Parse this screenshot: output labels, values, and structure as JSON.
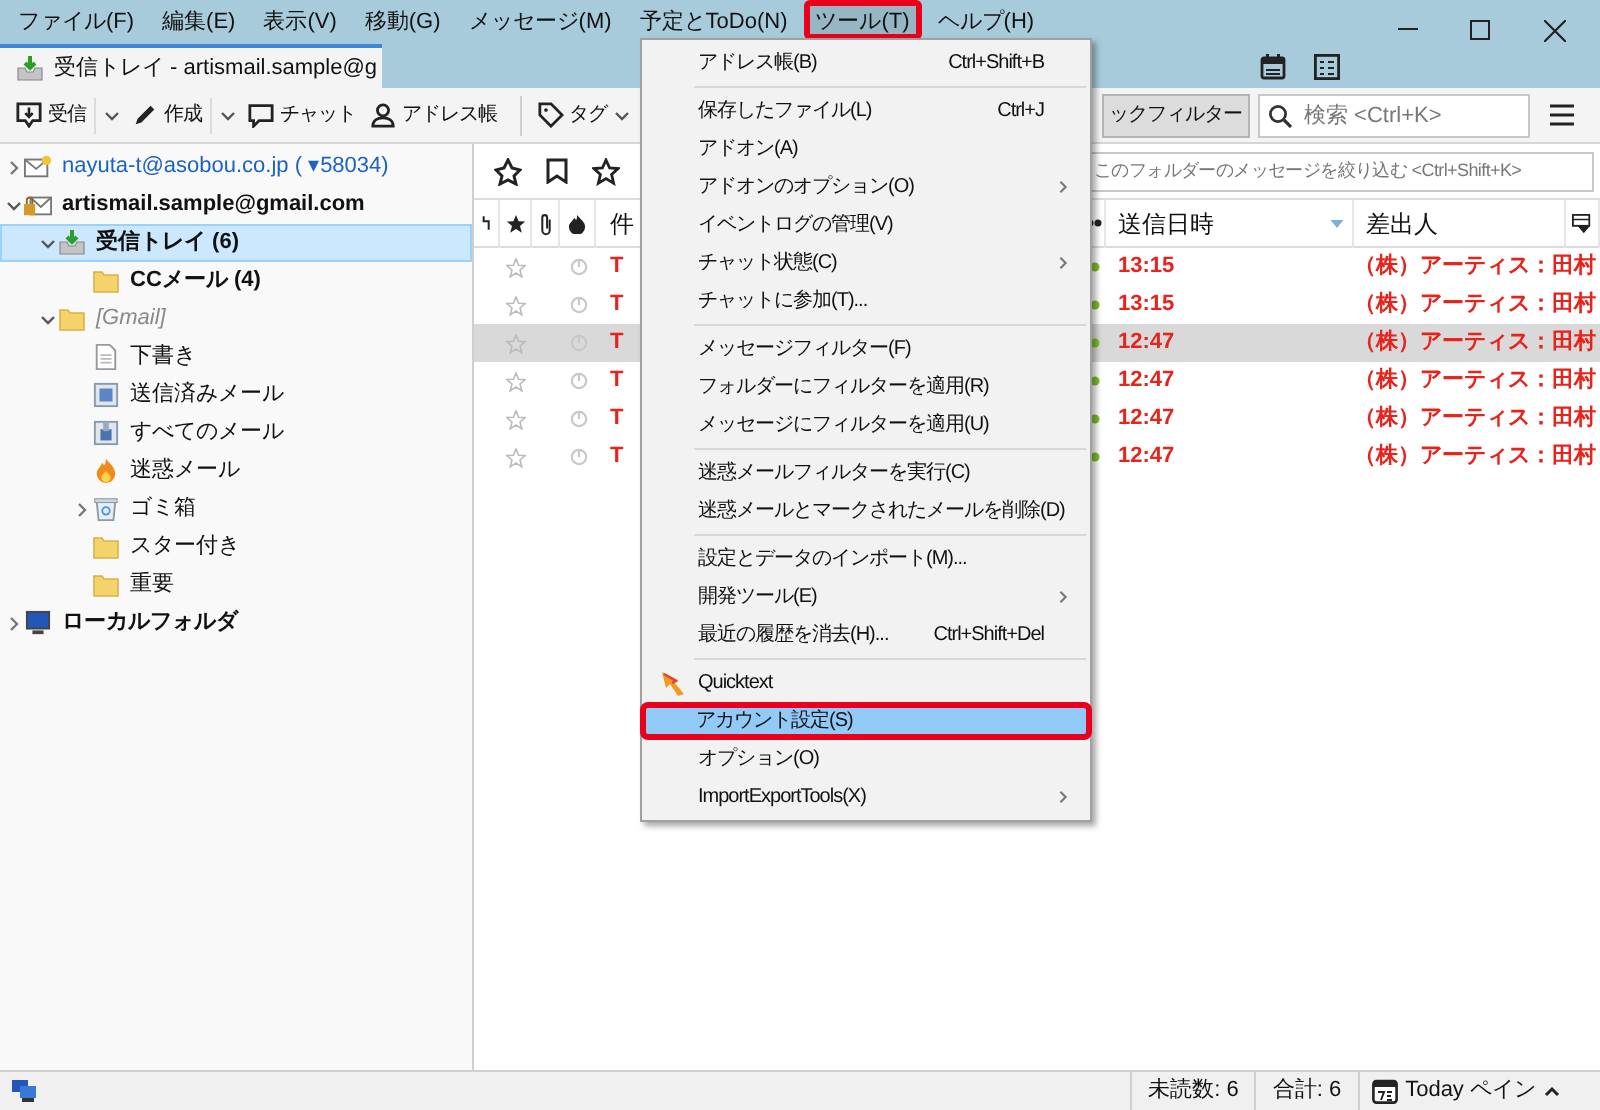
{
  "menu_bar": [
    {
      "label": "ファイル(F)",
      "annotated": false
    },
    {
      "label": "編集(E)",
      "annotated": false
    },
    {
      "label": "表示(V)",
      "annotated": false
    },
    {
      "label": "移動(G)",
      "annotated": false
    },
    {
      "label": "メッセージ(M)",
      "annotated": false
    },
    {
      "label": "予定とToDo(N)",
      "annotated": false
    },
    {
      "label": "ツール(T)",
      "annotated": true
    },
    {
      "label": "ヘルプ(H)",
      "annotated": false
    }
  ],
  "tabs": [
    {
      "label": "受信トレイ - artismail.sample@g",
      "selected": true
    }
  ],
  "toolbar": [
    {
      "kind": "get",
      "label": "受信",
      "dropdown": true
    },
    {
      "kind": "write",
      "label": "作成",
      "dropdown": true
    },
    {
      "kind": "chat",
      "label": "チャット",
      "dropdown": false
    },
    {
      "kind": "contacts",
      "label": "アドレス帳",
      "dropdown": false
    },
    {
      "kind": "tag",
      "label": "タグ",
      "dropdown": true
    }
  ],
  "quick_filter": {
    "button": "ックフィルター",
    "search_placeholder": "検索 <Ctrl+K>",
    "filter_placeholder": "このフォルダーのメッセージを絞り込む <Ctrl+Shift+K>"
  },
  "folders": [
    {
      "kind": "account",
      "label": "nayuta-t@asobou.co.jp ( ▾58034)",
      "new_mail": true,
      "bold": false,
      "selected": false,
      "expanded": false
    },
    {
      "kind": "account-locked",
      "label": "artismail.sample@gmail.com",
      "new_mail": false,
      "bold": true,
      "selected": false,
      "expanded": true,
      "children": [
        {
          "kind": "inbox",
          "label": "受信トレイ (6)",
          "new_mail": false,
          "bold": true,
          "selected": true,
          "expanded": true,
          "children": [
            {
              "kind": "folder",
              "label": "CCメール (4)",
              "new_mail": false,
              "bold": true,
              "selected": false
            }
          ]
        },
        {
          "kind": "virtual",
          "label": "[Gmail]",
          "new_mail": false,
          "bold": false,
          "selected": false,
          "expanded": true,
          "children": [
            {
              "kind": "drafts",
              "label": "下書き",
              "new_mail": false,
              "bold": false,
              "selected": false
            },
            {
              "kind": "sent",
              "label": "送信済みメール",
              "new_mail": false,
              "bold": false,
              "selected": false
            },
            {
              "kind": "archive",
              "label": "すべてのメール",
              "new_mail": false,
              "bold": false,
              "selected": false
            },
            {
              "kind": "junk",
              "label": "迷惑メール",
              "new_mail": false,
              "bold": false,
              "selected": false
            },
            {
              "kind": "trash",
              "label": "ゴミ箱",
              "new_mail": false,
              "bold": false,
              "selected": false,
              "expanded": false
            },
            {
              "kind": "folder",
              "label": "スター付き",
              "new_mail": false,
              "bold": false,
              "selected": false
            },
            {
              "kind": "folder",
              "label": "重要",
              "new_mail": false,
              "bold": false,
              "selected": false
            }
          ]
        }
      ]
    },
    {
      "kind": "local",
      "label": "ローカルフォルダ",
      "new_mail": false,
      "bold": true,
      "selected": false,
      "expanded": false
    }
  ],
  "message_list": {
    "columns": [
      {
        "label": "件"
      },
      {
        "label": "送信日時",
        "sorted": true
      },
      {
        "label": "差出人",
        "sorted": false
      }
    ],
    "rows": [
      {
        "subject": "T",
        "date": "13:15",
        "sender": "（株）アーティス：田村",
        "selected": false
      },
      {
        "subject": "T",
        "date": "13:15",
        "sender": "（株）アーティス：田村",
        "selected": false
      },
      {
        "subject": "T",
        "date": "12:47",
        "sender": "（株）アーティス：田村",
        "selected": true
      },
      {
        "subject": "T",
        "date": "12:47",
        "sender": "（株）アーティス：田村",
        "selected": false
      },
      {
        "subject": "T",
        "date": "12:47",
        "sender": "（株）アーティス：田村",
        "selected": false
      },
      {
        "subject": "T",
        "date": "12:47",
        "sender": "（株）アーティス：田村",
        "selected": false
      }
    ]
  },
  "tools_menu": [
    {
      "kind": "item",
      "label": "アドレス帳(B)",
      "shortcut": "Ctrl+Shift+B",
      "submenu": false,
      "highlighted": false,
      "annotated": false
    },
    {
      "kind": "separator"
    },
    {
      "kind": "item",
      "label": "保存したファイル(L)",
      "shortcut": "Ctrl+J",
      "submenu": false,
      "highlighted": false,
      "annotated": false
    },
    {
      "kind": "item",
      "label": "アドオン(A)",
      "submenu": false,
      "highlighted": false,
      "annotated": false
    },
    {
      "kind": "item",
      "label": "アドオンのオプション(O)",
      "submenu": true,
      "highlighted": false,
      "annotated": false
    },
    {
      "kind": "item",
      "label": "イベントログの管理(V)",
      "submenu": false,
      "highlighted": false,
      "annotated": false
    },
    {
      "kind": "item",
      "label": "チャット状態(C)",
      "submenu": true,
      "highlighted": false,
      "annotated": false
    },
    {
      "kind": "item",
      "label": "チャットに参加(T)...",
      "submenu": false,
      "highlighted": false,
      "annotated": false
    },
    {
      "kind": "separator"
    },
    {
      "kind": "item",
      "label": "メッセージフィルター(F)",
      "submenu": false,
      "highlighted": false,
      "annotated": false
    },
    {
      "kind": "item",
      "label": "フォルダーにフィルターを適用(R)",
      "submenu": false,
      "highlighted": false,
      "annotated": false
    },
    {
      "kind": "item",
      "label": "メッセージにフィルターを適用(U)",
      "submenu": false,
      "highlighted": false,
      "annotated": false
    },
    {
      "kind": "separator"
    },
    {
      "kind": "item",
      "label": "迷惑メールフィルターを実行(C)",
      "submenu": false,
      "highlighted": false,
      "annotated": false
    },
    {
      "kind": "item",
      "label": "迷惑メールとマークされたメールを削除(D)",
      "submenu": false,
      "highlighted": false,
      "annotated": false
    },
    {
      "kind": "separator"
    },
    {
      "kind": "item",
      "label": "設定とデータのインポート(M)...",
      "submenu": false,
      "highlighted": false,
      "annotated": false
    },
    {
      "kind": "item",
      "label": "開発ツール(E)",
      "submenu": true,
      "highlighted": false,
      "annotated": false
    },
    {
      "kind": "item",
      "label": "最近の履歴を消去(H)...",
      "shortcut": "Ctrl+Shift+Del",
      "submenu": false,
      "highlighted": false,
      "annotated": false
    },
    {
      "kind": "separator"
    },
    {
      "kind": "addon",
      "label": "Quicktext",
      "submenu": false,
      "highlighted": false,
      "annotated": false
    },
    {
      "kind": "item",
      "label": "アカウント設定(S)",
      "submenu": false,
      "highlighted": true,
      "annotated": true
    },
    {
      "kind": "item",
      "label": "オプション(O)",
      "submenu": false,
      "highlighted": false,
      "annotated": false
    },
    {
      "kind": "item",
      "label": "ImportExportTools(X)",
      "submenu": true,
      "highlighted": false,
      "annotated": false
    }
  ],
  "status_bar": {
    "unread": "未読数: 6",
    "total": "合計: 6",
    "today_pane": "Today ペイン"
  }
}
